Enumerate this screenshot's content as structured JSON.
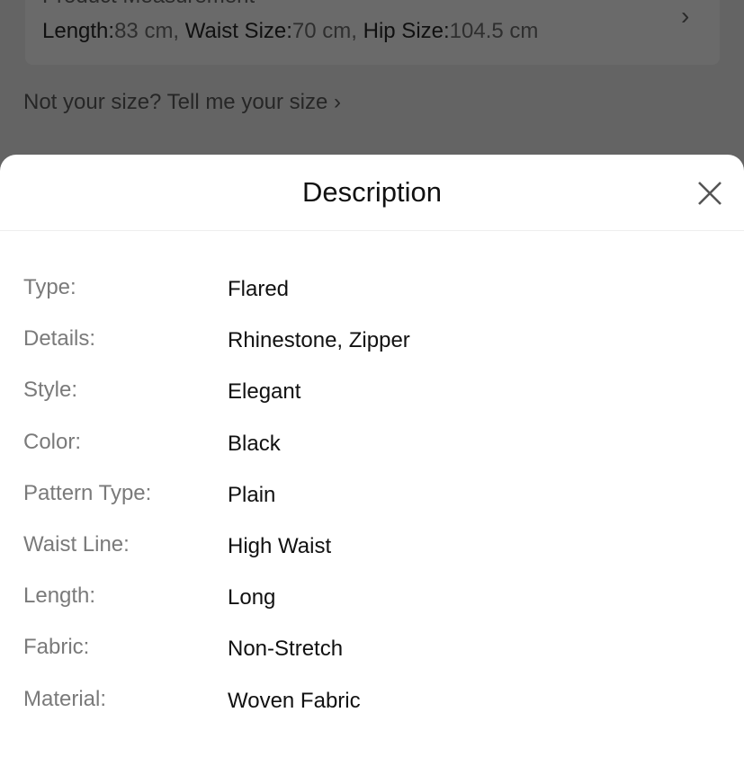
{
  "background": {
    "measurement_title": "Product Measurement",
    "measurements": [
      {
        "label": "Length:",
        "value": "83 cm, "
      },
      {
        "label": "Waist Size:",
        "value": "70 cm, "
      },
      {
        "label": "Hip Size:",
        "value": "104.5 cm"
      }
    ],
    "not_your_size": "Not your size? Tell me your size ›"
  },
  "sheet": {
    "title": "Description",
    "rows": [
      {
        "label": "Type:",
        "value": "Flared"
      },
      {
        "label": "Details:",
        "value": "Rhinestone, Zipper"
      },
      {
        "label": "Style:",
        "value": "Elegant"
      },
      {
        "label": "Color:",
        "value": "Black"
      },
      {
        "label": "Pattern Type:",
        "value": "Plain"
      },
      {
        "label": "Waist Line:",
        "value": "High Waist"
      },
      {
        "label": "Length:",
        "value": "Long"
      },
      {
        "label": "Fabric:",
        "value": "Non-Stretch"
      },
      {
        "label": "Material:",
        "value": "Woven Fabric"
      }
    ]
  }
}
